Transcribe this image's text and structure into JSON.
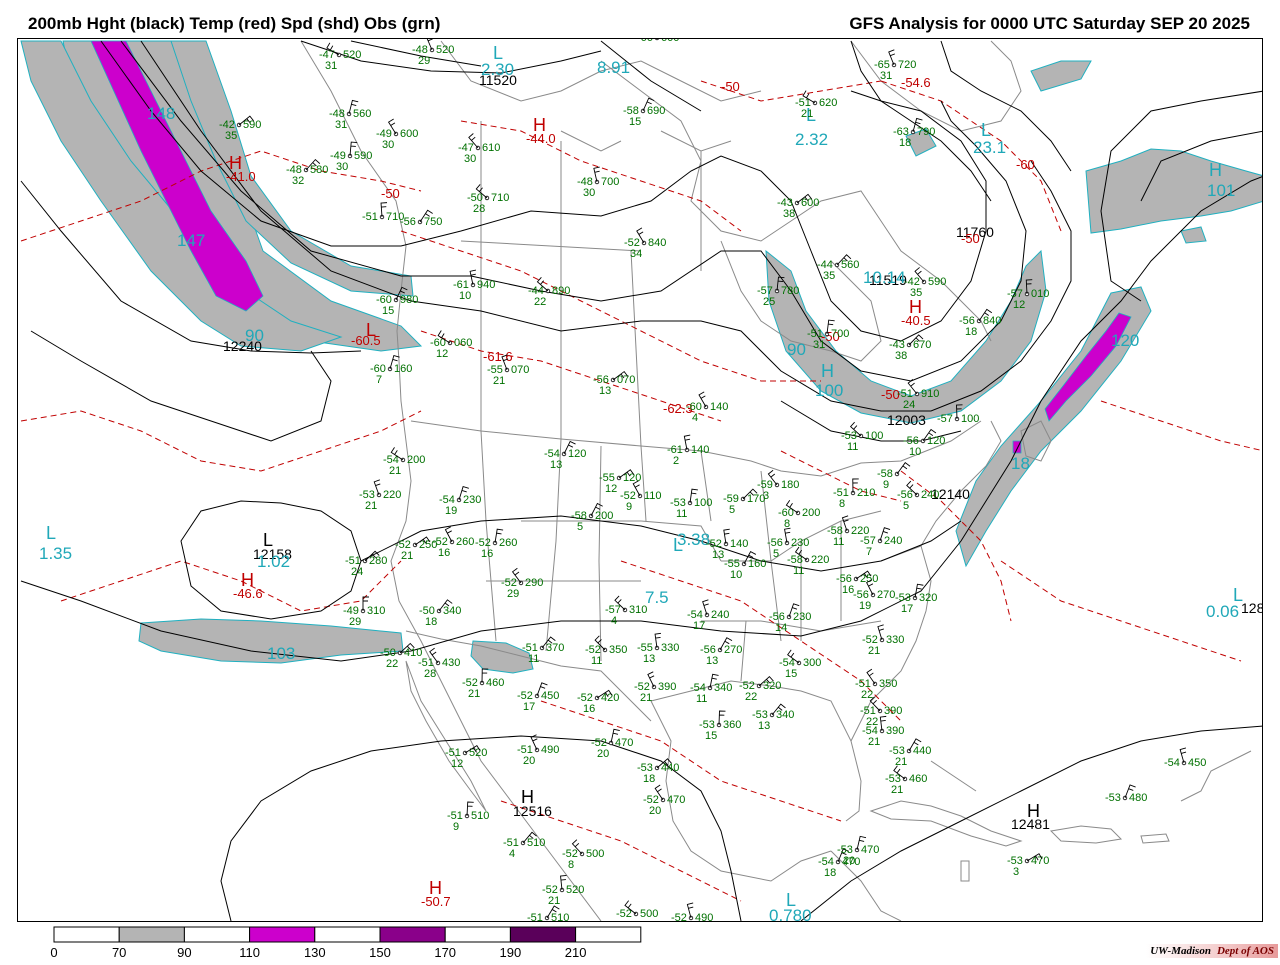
{
  "header": {
    "left_title": "200mb Hght (black) Temp (red) Spd (shd) Obs (grn)",
    "right_title": "GFS Analysis for 0000 UTC Saturday  SEP 20 2025"
  },
  "colors": {
    "height_contour": "#000000",
    "temperature_contour": "#c00000",
    "speed_70_90": "#b4b4b4",
    "speed_110_130": "#cc00cc",
    "speed_130_150": "#ffffff",
    "speed_150_170": "#8a008a",
    "speed_190_210": "#5a005a",
    "obs_text": "#007000",
    "pressure_center": "#20a8b8",
    "borders": "#888888"
  },
  "legend": {
    "ticks": [
      "0",
      "70",
      "90",
      "110",
      "130",
      "150",
      "170",
      "190",
      "210"
    ],
    "segments": [
      "#ffffff",
      "#b4b4b4",
      "#ffffff",
      "#cc00cc",
      "#ffffff",
      "#8a008a",
      "#ffffff",
      "#5a005a",
      "#ffffff"
    ]
  },
  "credit": {
    "org": "UW-Madison",
    "dept": "Dept of AOS"
  },
  "map_labels": {
    "height_labels": [
      "11520",
      "12240",
      "12158",
      "11519",
      "11760",
      "12003",
      "12140",
      "12516",
      "12481",
      "128"
    ],
    "temp_labels": [
      "-41.0",
      "-44.0",
      "-60.5",
      "-61.6",
      "-62.3",
      "-46.6",
      "-50.7",
      "-54.6",
      "-40.5",
      "-50",
      "-50",
      "-60",
      "-50",
      "-50",
      "-50"
    ],
    "highs": [
      "H",
      "H",
      "H",
      "H",
      "H",
      "H",
      "H",
      "H",
      "H"
    ],
    "lows": [
      "L",
      "L",
      "L",
      "L",
      "L",
      "L",
      "L",
      "L",
      "L"
    ],
    "center_values": [
      "148",
      "147",
      "90",
      "1.35",
      "1.02",
      "103",
      "2.30",
      "8.91",
      "2.32",
      "23.1",
      "101",
      "10.14",
      "90",
      "100",
      "120",
      "18",
      "3.38",
      "7.5",
      "0.06",
      "0.780"
    ],
    "stations": [
      {
        "t": "-47",
        "h": "520",
        "d": "31"
      },
      {
        "t": "-48",
        "h": "520",
        "d": "29"
      },
      {
        "t": "-48",
        "h": "560",
        "d": "31"
      },
      {
        "t": "-42",
        "h": "590",
        "d": "35"
      },
      {
        "t": "-49",
        "h": "600",
        "d": "30"
      },
      {
        "t": "-49",
        "h": "590",
        "d": "30"
      },
      {
        "t": "-48",
        "h": "580",
        "d": "32"
      },
      {
        "t": "-47",
        "h": "610",
        "d": "30"
      },
      {
        "t": "-51",
        "h": "710",
        "d": ""
      },
      {
        "t": "-56",
        "h": "750",
        "d": ""
      },
      {
        "t": "-50",
        "h": "710",
        "d": "28"
      },
      {
        "t": "-48",
        "h": "700",
        "d": "30"
      },
      {
        "t": "-58",
        "h": "690",
        "d": "15"
      },
      {
        "t": "-51",
        "h": "620",
        "d": "21"
      },
      {
        "t": "-65",
        "h": "720",
        "d": "31"
      },
      {
        "t": "-63",
        "h": "790",
        "d": "18"
      },
      {
        "t": "-43",
        "h": "600",
        "d": "38"
      },
      {
        "t": "-52",
        "h": "840",
        "d": "34"
      },
      {
        "t": "-57",
        "h": "780",
        "d": "25"
      },
      {
        "t": "-44",
        "h": "560",
        "d": "35"
      },
      {
        "t": "-42",
        "h": "590",
        "d": "35"
      },
      {
        "t": "-57",
        "h": "010",
        "d": "12"
      },
      {
        "t": "-56",
        "h": "840",
        "d": "18"
      },
      {
        "t": "-44",
        "h": "890",
        "d": "22"
      },
      {
        "t": "-61",
        "h": "940",
        "d": "10"
      },
      {
        "t": "-60",
        "h": "980",
        "d": "15"
      },
      {
        "t": "-60",
        "h": "060",
        "d": "12"
      },
      {
        "t": "-55",
        "h": "070",
        "d": "21"
      },
      {
        "t": "-60",
        "h": "160",
        "d": "7"
      },
      {
        "t": "-56",
        "h": "070",
        "d": "13"
      },
      {
        "t": "-60",
        "h": "140",
        "d": "4"
      },
      {
        "t": "-51",
        "h": "700",
        "d": "31"
      },
      {
        "t": "-43",
        "h": "670",
        "d": "38"
      },
      {
        "t": "-51",
        "h": "910",
        "d": "24"
      },
      {
        "t": "-57",
        "h": "100",
        "d": ""
      },
      {
        "t": "-56",
        "h": "120",
        "d": "10"
      },
      {
        "t": "-53",
        "h": "100",
        "d": "11"
      },
      {
        "t": "-61",
        "h": "140",
        "d": "2"
      },
      {
        "t": "-54",
        "h": "120",
        "d": "13"
      },
      {
        "t": "-54",
        "h": "200",
        "d": "21"
      },
      {
        "t": "-53",
        "h": "220",
        "d": "21"
      },
      {
        "t": "-54",
        "h": "230",
        "d": "19"
      },
      {
        "t": "-55",
        "h": "120",
        "d": "12"
      },
      {
        "t": "-52",
        "h": "110",
        "d": "9"
      },
      {
        "t": "-53",
        "h": "100",
        "d": "11"
      },
      {
        "t": "-59",
        "h": "170",
        "d": "5"
      },
      {
        "t": "-59",
        "h": "180",
        "d": "3"
      },
      {
        "t": "-51",
        "h": "210",
        "d": "8"
      },
      {
        "t": "-58",
        "h": "",
        "d": "9"
      },
      {
        "t": "-56",
        "h": "240",
        "d": "5"
      },
      {
        "t": "-56",
        "h": "230",
        "d": "5"
      },
      {
        "t": "-58",
        "h": "200",
        "d": "5"
      },
      {
        "t": "-60",
        "h": "200",
        "d": "8"
      },
      {
        "t": "-58",
        "h": "220",
        "d": "11"
      },
      {
        "t": "-57",
        "h": "240",
        "d": "7"
      },
      {
        "t": "-52",
        "h": "250",
        "d": "21"
      },
      {
        "t": "-52",
        "h": "260",
        "d": "16"
      },
      {
        "t": "-52",
        "h": "260",
        "d": "16"
      },
      {
        "t": "-51",
        "h": "280",
        "d": "24"
      },
      {
        "t": "-52",
        "h": "290",
        "d": "29"
      },
      {
        "t": "-49",
        "h": "310",
        "d": "29"
      },
      {
        "t": "-50",
        "h": "340",
        "d": "18"
      },
      {
        "t": "-57",
        "h": "310",
        "d": "4"
      },
      {
        "t": "-52",
        "h": "140",
        "d": "13"
      },
      {
        "t": "-55",
        "h": "160",
        "d": "10"
      },
      {
        "t": "-58",
        "h": "220",
        "d": "11"
      },
      {
        "t": "-54",
        "h": "240",
        "d": "17"
      },
      {
        "t": "-56",
        "h": "230",
        "d": "14"
      },
      {
        "t": "-56",
        "h": "250",
        "d": "16"
      },
      {
        "t": "-56",
        "h": "270",
        "d": "19"
      },
      {
        "t": "-53",
        "h": "320",
        "d": "17"
      },
      {
        "t": "-50",
        "h": "410",
        "d": "22"
      },
      {
        "t": "-51",
        "h": "430",
        "d": "28"
      },
      {
        "t": "-52",
        "h": "460",
        "d": "21"
      },
      {
        "t": "-51",
        "h": "370",
        "d": "11"
      },
      {
        "t": "-52",
        "h": "350",
        "d": "11"
      },
      {
        "t": "-55",
        "h": "330",
        "d": "13"
      },
      {
        "t": "-56",
        "h": "270",
        "d": "13"
      },
      {
        "t": "-54",
        "h": "300",
        "d": "15"
      },
      {
        "t": "-52",
        "h": "330",
        "d": "21"
      },
      {
        "t": "-52",
        "h": "450",
        "d": "17"
      },
      {
        "t": "-52",
        "h": "420",
        "d": "16"
      },
      {
        "t": "-52",
        "h": "390",
        "d": "21"
      },
      {
        "t": "-54",
        "h": "340",
        "d": "11"
      },
      {
        "t": "-52",
        "h": "320",
        "d": "22"
      },
      {
        "t": "-51",
        "h": "350",
        "d": "22"
      },
      {
        "t": "-53",
        "h": "360",
        "d": "15"
      },
      {
        "t": "-53",
        "h": "340",
        "d": "13"
      },
      {
        "t": "-51",
        "h": "390",
        "d": "22"
      },
      {
        "t": "-54",
        "h": "390",
        "d": "21"
      },
      {
        "t": "-53",
        "h": "440",
        "d": "21"
      },
      {
        "t": "-53",
        "h": "460",
        "d": "21"
      },
      {
        "t": "-54",
        "h": "450",
        "d": ""
      },
      {
        "t": "-53",
        "h": "480",
        "d": ""
      },
      {
        "t": "-51",
        "h": "520",
        "d": "12"
      },
      {
        "t": "-51",
        "h": "490",
        "d": "20"
      },
      {
        "t": "-52",
        "h": "470",
        "d": "20"
      },
      {
        "t": "-53",
        "h": "440",
        "d": "18"
      },
      {
        "t": "-52",
        "h": "470",
        "d": "20"
      },
      {
        "t": "-51",
        "h": "510",
        "d": "9"
      },
      {
        "t": "-51",
        "h": "510",
        "d": "4"
      },
      {
        "t": "-52",
        "h": "500",
        "d": "8"
      },
      {
        "t": "-52",
        "h": "520",
        "d": "21"
      },
      {
        "t": "-51",
        "h": "510",
        "d": ""
      },
      {
        "t": "-52",
        "h": "500",
        "d": ""
      },
      {
        "t": "-52",
        "h": "490",
        "d": ""
      },
      {
        "t": "-54",
        "h": "470",
        "d": "18"
      },
      {
        "t": "-53",
        "h": "470",
        "d": "3"
      },
      {
        "t": "-66",
        "h": "600",
        "d": ""
      },
      {
        "t": "-53",
        "h": "470",
        "d": "20"
      }
    ]
  }
}
